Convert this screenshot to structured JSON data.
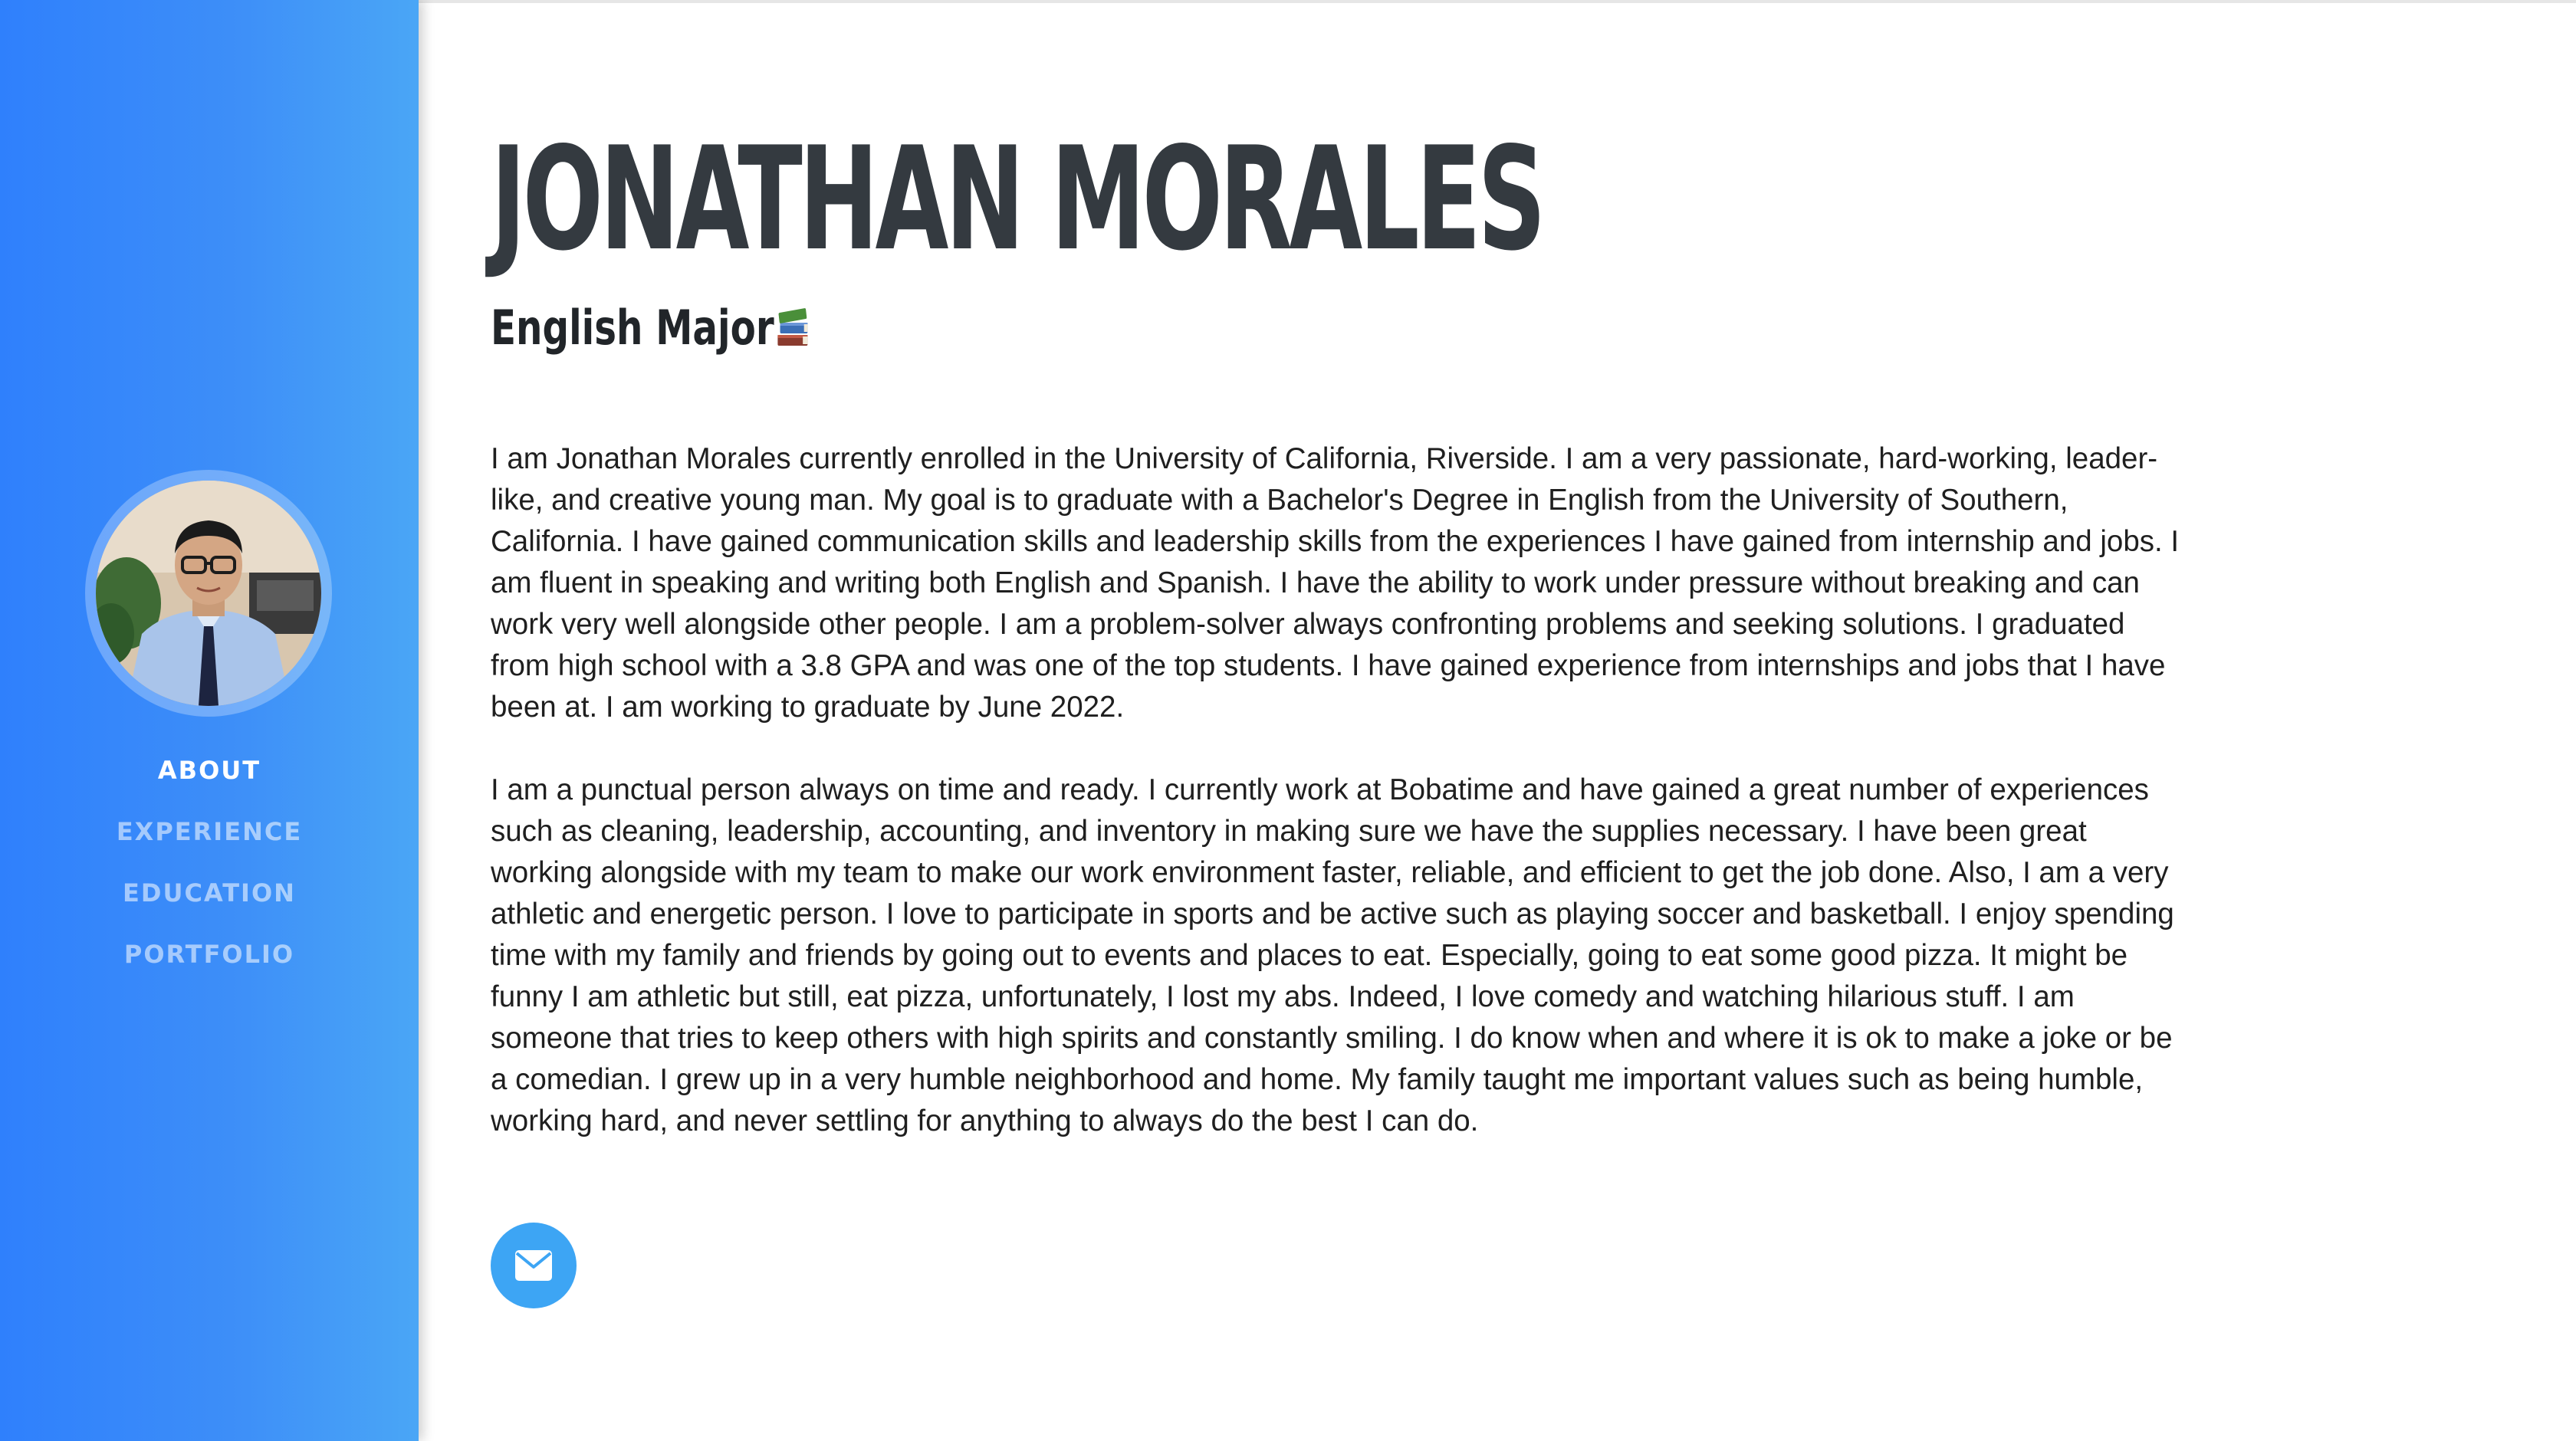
{
  "profile": {
    "name": "JONATHAN MORALES",
    "subtitle": "English Major",
    "avatar_icon": "profile-photo"
  },
  "nav": {
    "items": [
      {
        "label": "ABOUT",
        "active": true
      },
      {
        "label": "EXPERIENCE",
        "active": false
      },
      {
        "label": "EDUCATION",
        "active": false
      },
      {
        "label": "PORTFOLIO",
        "active": false
      }
    ]
  },
  "about": {
    "paragraphs": [
      "I am Jonathan Morales currently enrolled in the University of California, Riverside. I am a very passionate, hard-working, leader-like, and creative young man. My goal is to graduate with a Bachelor's Degree in English from the University of Southern, California. I have gained communication skills and leadership skills from the experiences I have gained from internship and jobs. I am fluent in speaking and writing both English and Spanish. I have the ability to work under pressure without breaking and can work very well alongside other people. I am a problem-solver always confronting problems and seeking solutions. I graduated from high school with a 3.8 GPA and was one of the top students. I have gained experience from internships and jobs that I have been at. I am working to graduate by June 2022.",
      "I am a punctual person always on time and ready. I currently work at Bobatime and have gained a great number of experiences such as cleaning, leadership, accounting, and inventory in making sure we have the supplies necessary. I have been great working alongside with my team to make our work environment faster, reliable, and efficient to get the job done. Also, I am a very athletic and energetic person. I love to participate in sports and be active such as playing soccer and basketball. I enjoy spending time with my family and friends by going out to events and places to eat. Especially, going to eat some good pizza. It might be funny I am athletic but still, eat pizza, unfortunately, I lost my abs. Indeed, I love comedy and watching hilarious stuff. I am someone that tries to keep others with high spirits and constantly smiling. I do know when and where it is ok to make a joke or be a comedian. I grew up in a very humble neighborhood and home. My family taught me important values such as being humble, working hard, and never settling for anything to always do the best I can do."
    ]
  },
  "social": {
    "email_icon": "envelope-icon"
  },
  "colors": {
    "sidebar_start": "#2f80fc",
    "sidebar_end": "#4aa6f6",
    "accent": "#3da5f4",
    "heading": "#343a40"
  }
}
